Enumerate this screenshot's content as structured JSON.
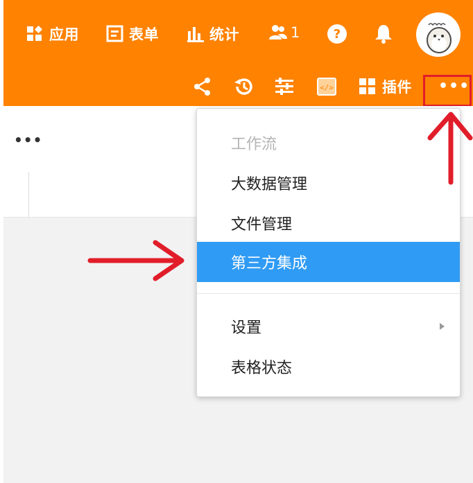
{
  "header": {
    "apps_label": "应用",
    "form_label": "表单",
    "stats_label": "统计",
    "members_count": "1",
    "plugins_label": "插件",
    "more_label": "•••"
  },
  "subbar": {
    "more_label": "•••"
  },
  "menu": {
    "items": [
      {
        "label": "工作流",
        "state": "disabled"
      },
      {
        "label": "大数据管理",
        "state": "normal"
      },
      {
        "label": "文件管理",
        "state": "normal"
      },
      {
        "label": "第三方集成",
        "state": "highlighted"
      },
      {
        "label": "设置",
        "state": "submenu"
      },
      {
        "label": "表格状态",
        "state": "normal"
      }
    ]
  },
  "colors": {
    "header_bg": "#ff8200",
    "highlight_bg": "#2f9bf4",
    "annotation_red": "#e11d2a"
  },
  "icons": [
    "apps-icon",
    "form-icon",
    "stats-icon",
    "members-icon",
    "help-icon",
    "bell-icon",
    "share-icon",
    "history-icon",
    "filter-icon",
    "embed-icon",
    "plugins-icon",
    "more-icon"
  ]
}
